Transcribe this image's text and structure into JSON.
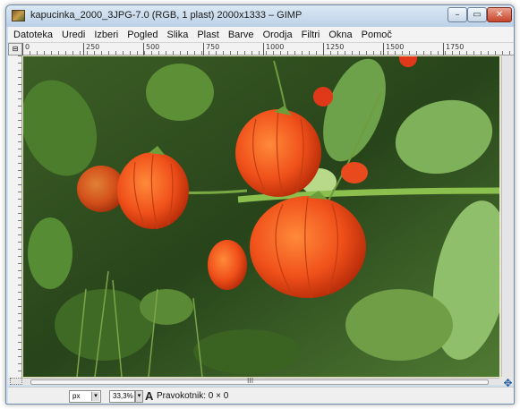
{
  "window": {
    "title": "kapucinka_2000_3JPG-7.0 (RGB, 1 plast) 2000x1333 – GIMP",
    "min_glyph": "–",
    "max_glyph": "▭",
    "close_glyph": "✕"
  },
  "menubar": {
    "items": [
      "Datoteka",
      "Uredi",
      "Izberi",
      "Pogled",
      "Slika",
      "Plast",
      "Barve",
      "Orodja",
      "Filtri",
      "Okna",
      "Pomoč"
    ]
  },
  "ruler": {
    "corner_glyph": "⊟",
    "ticks": [
      "0",
      "250",
      "500",
      "750",
      "1000",
      "1250",
      "1500",
      "1750"
    ]
  },
  "scrollbar": {
    "grip": "III"
  },
  "navigate_icon_glyph": "✥",
  "statusbar": {
    "unit": "px",
    "zoom": "33,3%",
    "tool_glyph": "A",
    "status": "Pravokotnik: 0 × 0",
    "arrow_glyph": "▾"
  },
  "colors": {
    "title_bg": "#cfe0f0",
    "foliage": "#2f4f1f",
    "lantern": "#f0501a"
  }
}
